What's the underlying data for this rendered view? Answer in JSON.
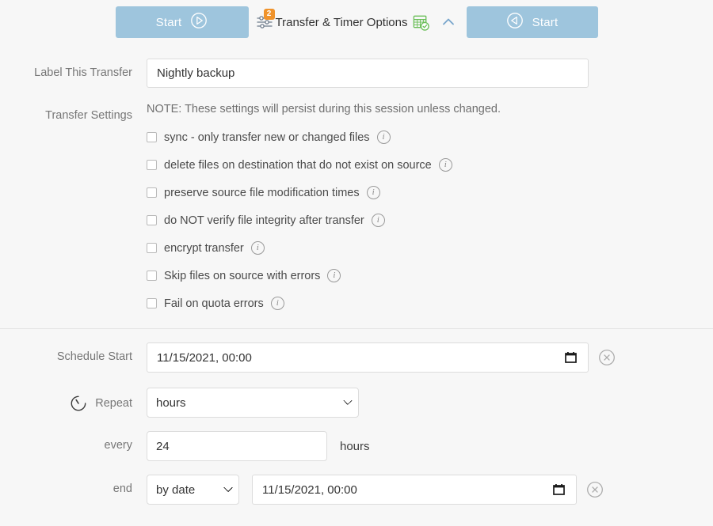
{
  "toolbar": {
    "start_left_label": "Start",
    "start_left_icon": "play-circle-icon",
    "options_badge": "2",
    "options_title": "Transfer & Timer Options",
    "sliders_icon": "sliders-icon",
    "calendar_timer_icon": "calendar-timer-icon",
    "collapse_icon": "chevron-up-icon",
    "start_right_label": "Start",
    "start_right_icon": "play-back-circle-icon",
    "button_color": "#9ec5dd",
    "badge_color": "#f0932b",
    "calendar_icon_color": "#6bbf59"
  },
  "label_transfer": {
    "label": "Label This Transfer",
    "value": "Nightly backup",
    "placeholder": ""
  },
  "transfer_settings": {
    "label": "Transfer Settings",
    "note": "NOTE: These settings will persist during this session unless changed.",
    "options": [
      {
        "label": "sync - only transfer new or changed files",
        "checked": false,
        "info": "i"
      },
      {
        "label": "delete files on destination that do not exist on source",
        "checked": false,
        "info": "i"
      },
      {
        "label": "preserve source file modification times",
        "checked": false,
        "info": "i"
      },
      {
        "label": "do NOT verify file integrity after transfer",
        "checked": false,
        "info": "i"
      },
      {
        "label": "encrypt transfer",
        "checked": false,
        "info": "i"
      },
      {
        "label": "Skip files on source with errors",
        "checked": false,
        "info": "i"
      },
      {
        "label": "Fail on quota errors",
        "checked": false,
        "info": "i"
      }
    ]
  },
  "schedule": {
    "start_label": "Schedule Start",
    "start_value": "11/15/2021, 00:00",
    "repeat_label": "Repeat",
    "repeat_icon": "timer-icon",
    "repeat_value": "hours",
    "repeat_options": [
      "hours"
    ],
    "every_label": "every",
    "every_value": "24",
    "every_unit": "hours",
    "end_label": "end",
    "end_type_value": "by date",
    "end_type_options": [
      "by date"
    ],
    "end_date_value": "11/15/2021, 00:00",
    "calendar_icon": "calendar-icon",
    "clear_icon": "clear-circle-icon"
  }
}
